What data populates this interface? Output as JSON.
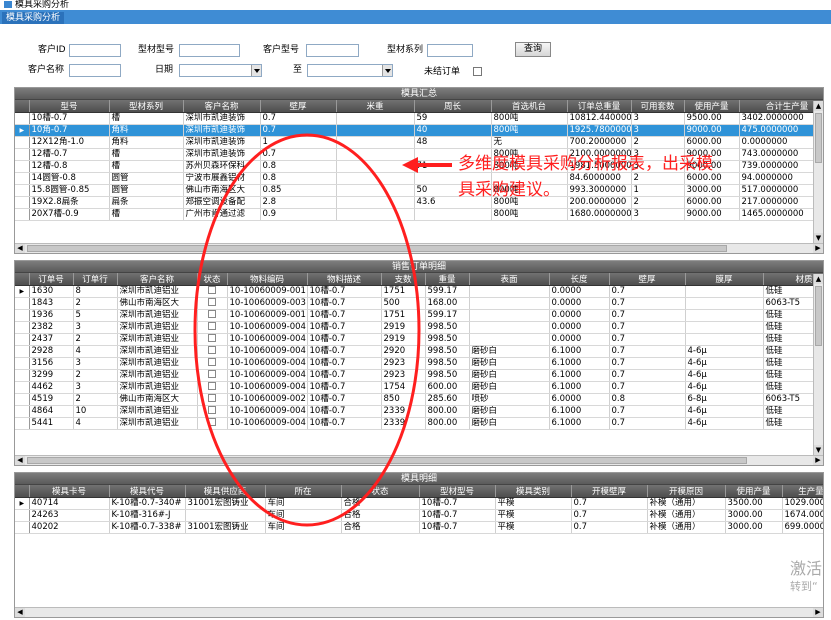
{
  "window": {
    "title": "模具采购分析",
    "tab": "模具采购分析"
  },
  "filters": {
    "customer_id_label": "客户ID",
    "material_model_label": "型材型号",
    "customer_model_label": "客户型号",
    "material_series_label": "型材系列",
    "customer_name_label": "客户名称",
    "date_label": "日期",
    "to_label": "至",
    "unfinished_label": "未结订单",
    "query_button": "查询"
  },
  "mold_summary": {
    "title": "模具汇总",
    "columns": [
      "型号",
      "型材系列",
      "客户名称",
      "壁厚",
      "米重",
      "周长",
      "首选机台",
      "订单总重量",
      "可用套数",
      "使用产量",
      "合计生产量"
    ],
    "rows": [
      [
        "10槽-0.7",
        "槽",
        "深圳市凯迪装饰",
        "0.7",
        "",
        "59",
        "800吨",
        "10812.440000",
        "3",
        "9500.00",
        "3402.0000000"
      ],
      [
        "10角-0.7",
        "角料",
        "深圳市凯迪装饰",
        "0.7",
        "",
        "40",
        "800吨",
        "1925.7800000",
        "3",
        "9000.00",
        "475.0000000"
      ],
      [
        "12X12角-1.0",
        "角料",
        "深圳市凯迪装饰",
        "1",
        "",
        "48",
        "无",
        "700.2000000",
        "2",
        "6000.00",
        "0.0000000"
      ],
      [
        "12槽-0.7",
        "槽",
        "深圳市凯迪装饰",
        "0.7",
        "",
        "",
        "800吨",
        "2100.0000000",
        "3",
        "9000.00",
        "743.0000000"
      ],
      [
        "12槽-0.8",
        "槽",
        "苏州贝森环保科",
        "0.8",
        "",
        "71",
        "800吨",
        "1981.5000000",
        "3",
        "9000.00",
        "739.0000000"
      ],
      [
        "14圆管-0.8",
        "圆管",
        "宁波市展鑫铝材",
        "0.8",
        "",
        "",
        "",
        "84.6000000",
        "2",
        "6000.00",
        "94.0000000"
      ],
      [
        "15.8圆管-0.85",
        "圆管",
        "佛山市南海区大",
        "0.85",
        "",
        "50",
        "800吨",
        "993.3000000",
        "1",
        "3000.00",
        "517.0000000"
      ],
      [
        "19X2.8扁条",
        "扁条",
        "郑振空调设备配",
        "2.8",
        "",
        "43.6",
        "800吨",
        "200.0000000",
        "2",
        "6000.00",
        "217.0000000"
      ],
      [
        "20X7槽-0.9",
        "槽",
        "广州市肯通过滤",
        "0.9",
        "",
        "",
        "800吨",
        "1680.0000000",
        "3",
        "9000.00",
        "1465.0000000"
      ]
    ]
  },
  "sales_orders": {
    "title": "销售订单明细",
    "columns": [
      "订单号",
      "订单行",
      "客户名称",
      "状态",
      "物料编码",
      "物料描述",
      "支数",
      "重量",
      "表面",
      "长度",
      "壁厚",
      "膜厚",
      "材质"
    ],
    "rows": [
      [
        "1630",
        "8",
        "深圳市凯迪铝业",
        "",
        "10-10060009-001",
        "10槽-0.7",
        "1751",
        "599.17",
        "",
        "0.0000",
        "0.7",
        "",
        "低硅"
      ],
      [
        "1843",
        "2",
        "佛山市南海区大",
        "",
        "10-10060009-003",
        "10槽-0.7",
        "500",
        "168.00",
        "",
        "0.0000",
        "0.7",
        "",
        "6063-T5"
      ],
      [
        "1936",
        "5",
        "深圳市凯迪铝业",
        "",
        "10-10060009-001",
        "10槽-0.7",
        "1751",
        "599.17",
        "",
        "0.0000",
        "0.7",
        "",
        "低硅"
      ],
      [
        "2382",
        "3",
        "深圳市凯迪铝业",
        "",
        "10-10060009-004",
        "10槽-0.7",
        "2919",
        "998.50",
        "",
        "0.0000",
        "0.7",
        "",
        "低硅"
      ],
      [
        "2437",
        "2",
        "深圳市凯迪铝业",
        "",
        "10-10060009-004",
        "10槽-0.7",
        "2919",
        "998.50",
        "",
        "0.0000",
        "0.7",
        "",
        "低硅"
      ],
      [
        "2928",
        "4",
        "深圳市凯迪铝业",
        "",
        "10-10060009-004",
        "10槽-0.7",
        "2920",
        "998.50",
        "磨砂白",
        "6.1000",
        "0.7",
        "4-6μ",
        "低硅"
      ],
      [
        "3156",
        "3",
        "深圳市凯迪铝业",
        "",
        "10-10060009-004",
        "10槽-0.7",
        "2923",
        "998.50",
        "磨砂白",
        "6.1000",
        "0.7",
        "4-6μ",
        "低硅"
      ],
      [
        "3299",
        "2",
        "深圳市凯迪铝业",
        "",
        "10-10060009-004",
        "10槽-0.7",
        "2923",
        "998.50",
        "磨砂白",
        "6.1000",
        "0.7",
        "4-6μ",
        "低硅"
      ],
      [
        "4462",
        "3",
        "深圳市凯迪铝业",
        "",
        "10-10060009-004",
        "10槽-0.7",
        "1754",
        "600.00",
        "磨砂白",
        "6.1000",
        "0.7",
        "4-6μ",
        "低硅"
      ],
      [
        "4519",
        "2",
        "佛山市南海区大",
        "",
        "10-10060009-002",
        "10槽-0.7",
        "850",
        "285.60",
        "喷砂",
        "6.0000",
        "0.8",
        "6-8μ",
        "6063-T5"
      ],
      [
        "4864",
        "10",
        "深圳市凯迪铝业",
        "",
        "10-10060009-004",
        "10槽-0.7",
        "2339",
        "800.00",
        "磨砂白",
        "6.1000",
        "0.7",
        "4-6μ",
        "低硅"
      ],
      [
        "5441",
        "4",
        "深圳市凯迪铝业",
        "",
        "10-10060009-004",
        "10槽-0.7",
        "2339",
        "800.00",
        "磨砂白",
        "6.1000",
        "0.7",
        "4-6μ",
        "低硅"
      ]
    ]
  },
  "mold_details": {
    "title": "模具明细",
    "columns": [
      "模具卡号",
      "模具代号",
      "模具供应商",
      "所在",
      "状态",
      "型材型号",
      "模具类别",
      "开模壁厚",
      "开模原因",
      "使用产量",
      "生产量"
    ],
    "rows": [
      [
        "40714",
        "K-10槽-0.7-340#",
        "31001宏图铸业",
        "车间",
        "合格",
        "10槽-0.7",
        "平模",
        "0.7",
        "补模（通用）",
        "3500.00",
        "1029.000"
      ],
      [
        "24263",
        "K-10槽-316#-J",
        "",
        "车间",
        "合格",
        "10槽-0.7",
        "平模",
        "0.7",
        "补模（通用）",
        "3000.00",
        "1674.000"
      ],
      [
        "40202",
        "K-10槽-0.7-338#",
        "31001宏图铸业",
        "车间",
        "合格",
        "10槽-0.7",
        "平模",
        "0.7",
        "补模（通用）",
        "3000.00",
        "699.0000"
      ]
    ]
  },
  "annotation": {
    "line1": "多维度模具采购分析报表，出采模",
    "line2": "具采购建议。",
    "color": "#ff1f1f"
  },
  "watermark": {
    "line1": "激活",
    "line2": "转到“"
  }
}
